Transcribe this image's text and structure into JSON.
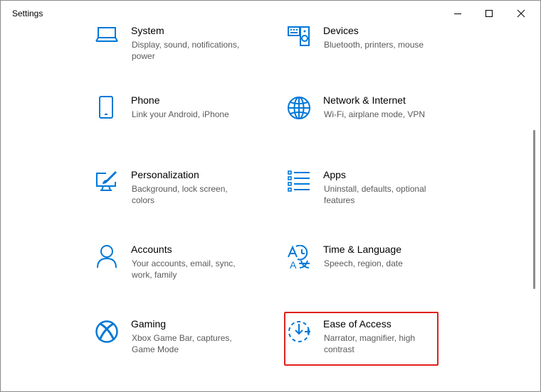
{
  "window": {
    "title": "Settings",
    "controls": [
      "minimize",
      "maximize",
      "close"
    ]
  },
  "colors": {
    "accent": "#0078d7",
    "highlight_border": "#e0201b",
    "description_text": "#5a5a5a"
  },
  "categories": [
    {
      "name": "System",
      "description": "Display, sound, notifications, power",
      "icon": "laptop-icon"
    },
    {
      "name": "Devices",
      "description": "Bluetooth, printers, mouse",
      "icon": "keyboard-speaker-icon"
    },
    {
      "name": "Phone",
      "description": "Link your Android, iPhone",
      "icon": "phone-icon"
    },
    {
      "name": "Network & Internet",
      "description": "Wi-Fi, airplane mode, VPN",
      "icon": "globe-icon"
    },
    {
      "name": "Personalization",
      "description": "Background, lock screen, colors",
      "icon": "paintbrush-monitor-icon"
    },
    {
      "name": "Apps",
      "description": "Uninstall, defaults, optional features",
      "icon": "apps-list-icon"
    },
    {
      "name": "Accounts",
      "description": "Your accounts, email, sync, work, family",
      "icon": "person-icon"
    },
    {
      "name": "Time & Language",
      "description": "Speech, region, date",
      "icon": "time-language-icon"
    },
    {
      "name": "Gaming",
      "description": "Xbox Game Bar, captures, Game Mode",
      "icon": "xbox-icon"
    },
    {
      "name": "Ease of Access",
      "description": "Narrator, magnifier, high contrast",
      "icon": "ease-of-access-icon",
      "highlighted": true
    }
  ]
}
